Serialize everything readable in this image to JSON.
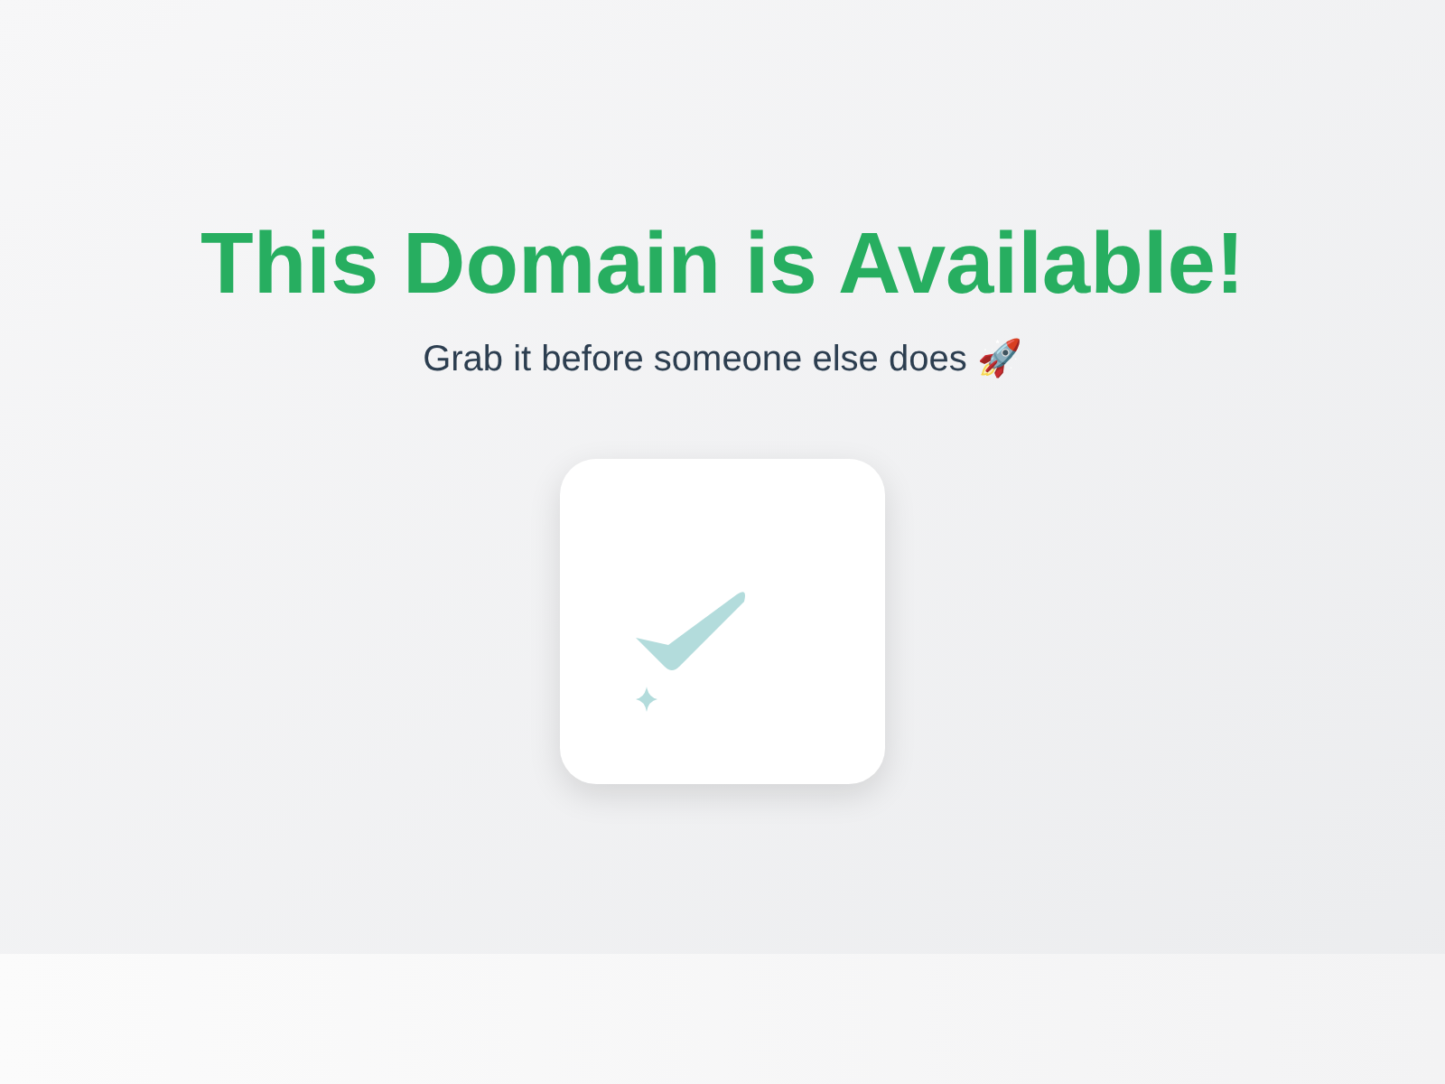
{
  "title": "This Domain is Available!",
  "subtitle": "Grab it before someone else does 🚀"
}
